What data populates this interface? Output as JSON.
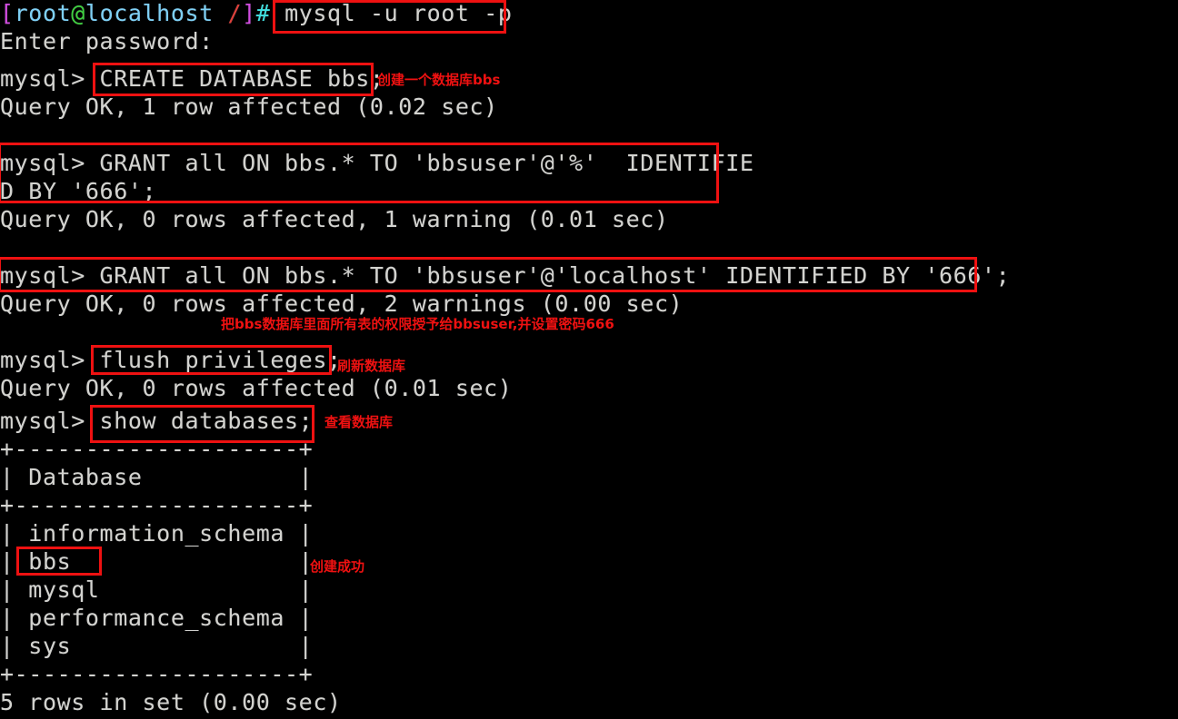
{
  "terminal": {
    "background_color": "#000000",
    "text_color": "#d3d3cf",
    "annotation_color": "#ee1111",
    "prompt": {
      "open_bracket": "[",
      "user": "root",
      "at": "@",
      "host": "localhost",
      "path": " /",
      "close_bracket": "]",
      "hash": "# "
    },
    "lines": [
      {
        "id": "l1",
        "text": "mysql -u root -p"
      },
      {
        "id": "l2",
        "text": "Enter password:"
      },
      {
        "id": "l3",
        "text": "mysql> CREATE DATABASE bbs;"
      },
      {
        "id": "l4",
        "text": "Query OK, 1 row affected (0.02 sec)"
      },
      {
        "id": "l5",
        "text": "mysql> GRANT all ON bbs.* TO 'bbsuser'@'%'  IDENTIFIE"
      },
      {
        "id": "l6",
        "text": "D BY '666';"
      },
      {
        "id": "l7",
        "text": "Query OK, 0 rows affected, 1 warning (0.01 sec)"
      },
      {
        "id": "l8",
        "text": "mysql> GRANT all ON bbs.* TO 'bbsuser'@'localhost' IDENTIFIED BY '666';"
      },
      {
        "id": "l9",
        "text": "Query OK, 0 rows affected, 2 warnings (0.00 sec)"
      },
      {
        "id": "l10",
        "text": "mysql> flush privileges;"
      },
      {
        "id": "l11",
        "text": "Query OK, 0 rows affected (0.01 sec)"
      },
      {
        "id": "l12",
        "text": "mysql> show databases;"
      },
      {
        "id": "l13",
        "text": "+--------------------+"
      },
      {
        "id": "l14",
        "text": "| Database           |"
      },
      {
        "id": "l15",
        "text": "+--------------------+"
      },
      {
        "id": "l16",
        "text": "| information_schema |"
      },
      {
        "id": "l17",
        "text": "| bbs                |"
      },
      {
        "id": "l18",
        "text": "| mysql              |"
      },
      {
        "id": "l19",
        "text": "| performance_schema |"
      },
      {
        "id": "l20",
        "text": "| sys                |"
      },
      {
        "id": "l21",
        "text": "+--------------------+"
      },
      {
        "id": "l22",
        "text": "5 rows in set (0.00 sec)"
      }
    ],
    "command_prompt_line": {
      "command": "mysql -u root -p"
    },
    "notes": [
      {
        "id": "n1",
        "text": "创建一个数据库bbs"
      },
      {
        "id": "n2",
        "text": "把bbs数据库里面所有表的权限授予给bbsuser,并设置密码666"
      },
      {
        "id": "n3",
        "text": "刷新数据库"
      },
      {
        "id": "n4",
        "text": "查看数据库"
      },
      {
        "id": "n5",
        "text": "创建成功"
      }
    ],
    "highlight_boxes": [
      {
        "id": "b1",
        "label": "mysql-login-command"
      },
      {
        "id": "b2",
        "label": "create-database-command"
      },
      {
        "id": "b3",
        "label": "grant-remote-command"
      },
      {
        "id": "b4",
        "label": "grant-localhost-command"
      },
      {
        "id": "b5",
        "label": "flush-privileges-command"
      },
      {
        "id": "b6",
        "label": "show-databases-command"
      },
      {
        "id": "b7",
        "label": "bbs-database-row"
      }
    ]
  }
}
